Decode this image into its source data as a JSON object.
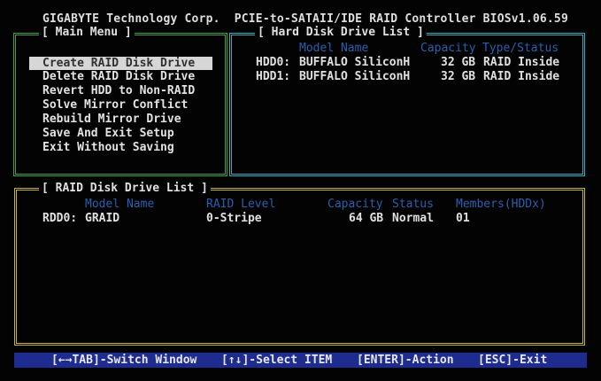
{
  "bios_title": "GIGABYTE Technology Corp.  PCIE-to-SATAII/IDE RAID Controller BIOSv1.06.59",
  "main_menu": {
    "title": "[ Main Menu ]",
    "items": [
      {
        "label": "Create RAID Disk Drive",
        "selected": true
      },
      {
        "label": "Delete RAID Disk Drive",
        "selected": false
      },
      {
        "label": "Revert HDD to Non-RAID",
        "selected": false
      },
      {
        "label": "Solve Mirror Conflict",
        "selected": false
      },
      {
        "label": "Rebuild Mirror Drive",
        "selected": false
      },
      {
        "label": "Save And Exit Setup",
        "selected": false
      },
      {
        "label": "Exit Without Saving",
        "selected": false
      }
    ]
  },
  "hdd_list": {
    "title": "[ Hard Disk Drive List ]",
    "headers": {
      "model": "Model Name",
      "capacity": "Capacity",
      "type_status": "Type/Status"
    },
    "rows": [
      {
        "id": "HDD0:",
        "model": "BUFFALO SiliconH",
        "capacity": "32 GB",
        "type_status": "RAID Inside"
      },
      {
        "id": "HDD1:",
        "model": "BUFFALO SiliconH",
        "capacity": "32 GB",
        "type_status": "RAID Inside"
      }
    ]
  },
  "raid_list": {
    "title": "[ RAID Disk Drive List ]",
    "headers": {
      "model": "Model Name",
      "level": "RAID Level",
      "capacity": "Capacity",
      "status": "Status",
      "members": "Members(HDDx)"
    },
    "rows": [
      {
        "id": "RDD0:",
        "model": "GRAID",
        "level": "0-Stripe",
        "capacity": "64 GB",
        "status": "Normal",
        "members": "01"
      }
    ]
  },
  "status_bar": {
    "switch": "[←→TAB]-Switch Window",
    "select": "[↑↓]-Select ITEM",
    "action": "[ENTER]-Action",
    "exit": "[ESC]-Exit"
  },
  "colors": {
    "background": "#030303",
    "main_menu_border": "#3fa04a",
    "hdd_border": "#39a9bd",
    "raid_border": "#c4b341",
    "header_text": "#2b5fae",
    "status_bar_bg": "#1d2c8e",
    "selection_bg": "#d6d6d6"
  }
}
